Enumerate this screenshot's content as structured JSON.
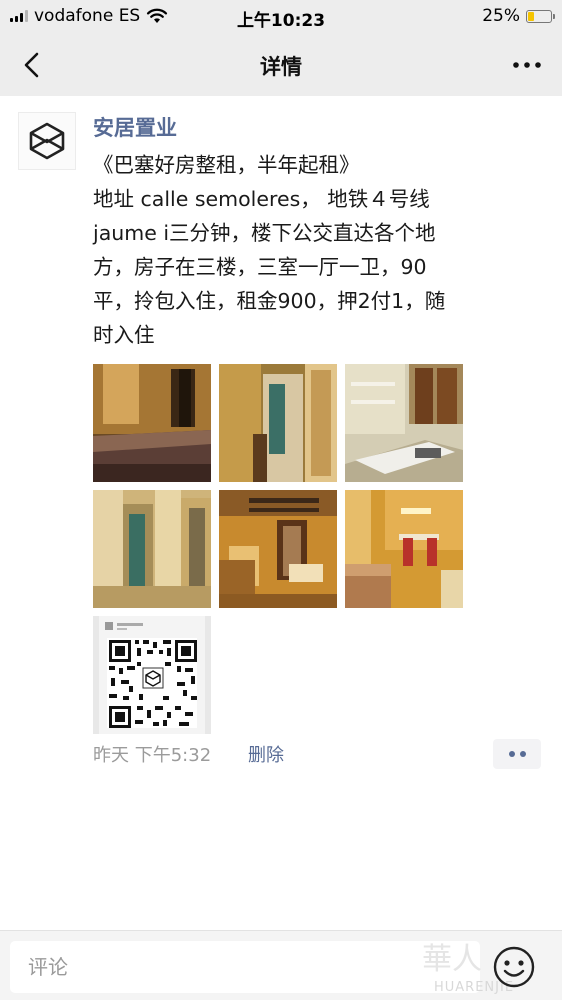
{
  "status_bar": {
    "carrier": "vodafone ES",
    "time": "上午10:23",
    "battery_percent": "25%",
    "battery_level": 0.25
  },
  "nav": {
    "title": "详情",
    "back_icon": "chevron-left-icon",
    "more_icon": "ellipsis-icon"
  },
  "post": {
    "author": "安居置业",
    "lines": [
      "《巴塞好房整租，半年起租》",
      "地址 calle semoleres， 地铁４号线",
      "jaume i三分钟，楼下公交直达各个地",
      "方，房子在三楼，三室一厅一卫，90",
      "平，拎包入住，租金900，押2付1，随",
      "时入住"
    ],
    "photos": [
      "bedroom-photo",
      "hallway-photo",
      "single-bedroom-photo",
      "corridor-photo",
      "living-room-photo",
      "dining-area-photo",
      "qr-code-photo"
    ],
    "timestamp": "昨天 下午5:32",
    "delete_label": "删除"
  },
  "comment_bar": {
    "placeholder": "评论",
    "watermark": "HUARENJIE"
  },
  "colors": {
    "link": "#576b95",
    "meta": "#9b9b9b",
    "bar_background": "#ededed"
  }
}
